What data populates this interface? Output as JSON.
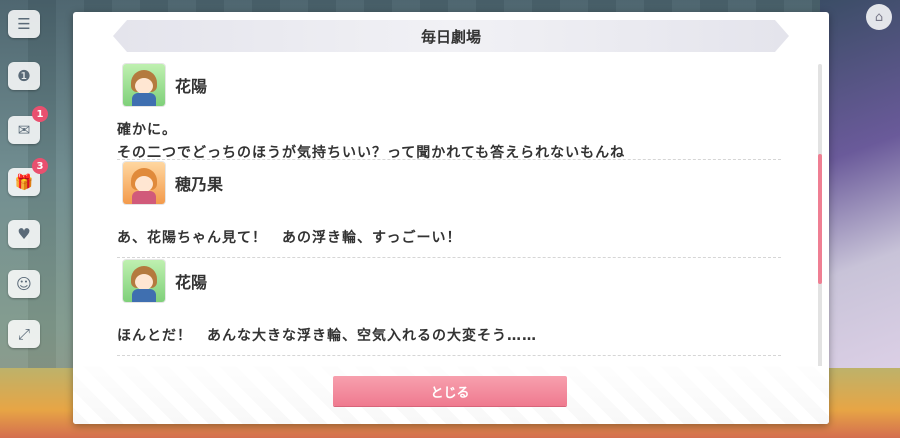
{
  "dialog": {
    "title": "毎日劇場",
    "close_label": "とじる"
  },
  "log": [
    {
      "speaker": "花陽",
      "avatar": "hanayo-avatar",
      "lines": [
        "確かに。",
        "その二つでどっちのほうが気持ちいい？って聞かれても答えられないもんね"
      ]
    },
    {
      "speaker": "穂乃果",
      "avatar": "honoka-avatar",
      "lines": [
        "あ、花陽ちゃん見て！　あの浮き輪、すっごーい！"
      ]
    },
    {
      "speaker": "花陽",
      "avatar": "hanayo-avatar",
      "lines": [
        "ほんとだ！　あんな大きな浮き輪、空気入れるの大変そう……"
      ]
    }
  ],
  "hud": {
    "badges": [
      "1",
      "3"
    ]
  },
  "colors": {
    "accent": "#ef7a8f",
    "dialog_bg": "#ffffff",
    "title_bar": "#ececf2"
  }
}
